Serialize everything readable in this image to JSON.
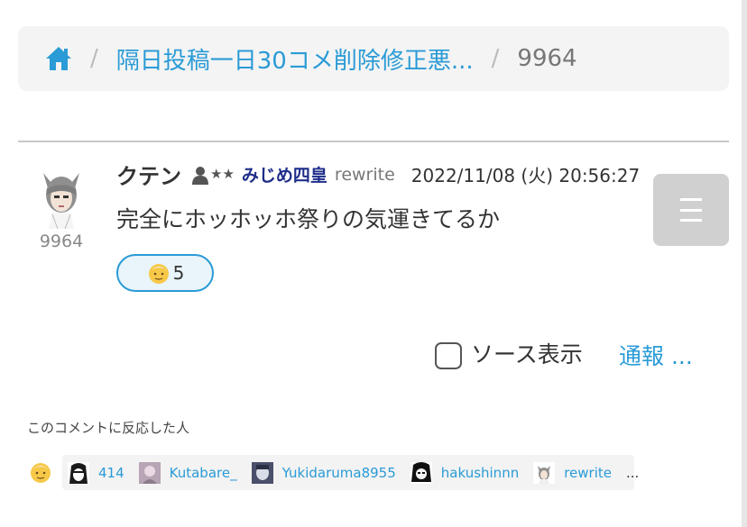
{
  "breadcrumb": {
    "home_icon": "home-icon",
    "separator": "/",
    "thread_title": "隔日投稿一日30コメ削除修正悪...",
    "current": "9964"
  },
  "comment": {
    "avatar_id": "9964",
    "username": "クテン",
    "rank_stars": [
      "★",
      "★"
    ],
    "rank_title": "みじめ四皇",
    "rewrite_tag": "rewrite",
    "timestamp": "2022/11/08 (火) 20:56:27",
    "text": "完全にホッホッホ祭りの気運きてるか",
    "reaction_count": "5"
  },
  "actions": {
    "source_label": "ソース表示",
    "source_checked": false,
    "report_label": "通報 ..."
  },
  "reactors": {
    "title": "このコメントに反応した人",
    "users": [
      {
        "name": "414"
      },
      {
        "name": "Kutabare_"
      },
      {
        "name": "Yukidaruma8955"
      },
      {
        "name": "hakushinnn"
      },
      {
        "name": "rewrite"
      }
    ],
    "more": "..."
  },
  "colors": {
    "link": "#2a9bd6",
    "rank_title": "#1f2d8a",
    "menu_button": "#d0d0d0",
    "breadcrumb_bg": "#f4f4f4"
  }
}
